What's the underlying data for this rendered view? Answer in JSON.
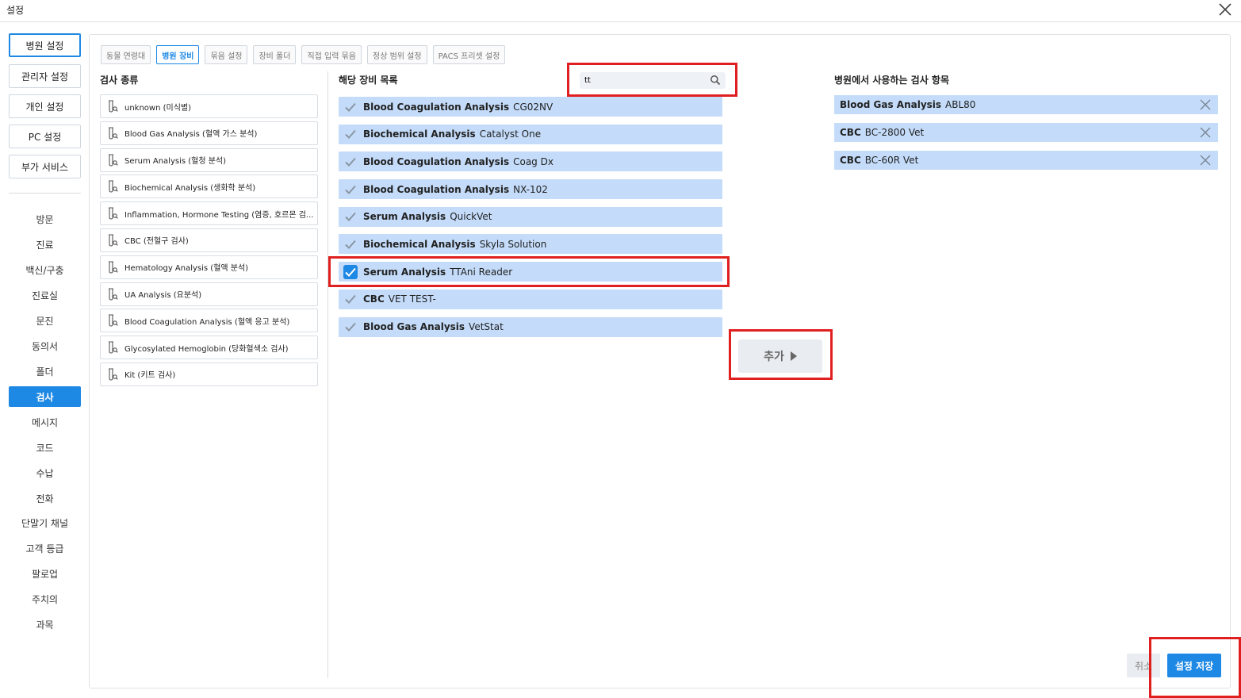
{
  "window": {
    "title": "설정"
  },
  "nav": {
    "buttons": [
      "병원 설정",
      "관리자 설정",
      "개인 설정",
      "PC 설정",
      "부가 서비스"
    ],
    "items": [
      "방문",
      "진료",
      "백신/구충",
      "진료실",
      "문진",
      "동의서",
      "폴더",
      "검사",
      "메시지",
      "코드",
      "수납",
      "전화",
      "단말기 채널",
      "고객 등급",
      "팔로업",
      "주치의",
      "과목"
    ]
  },
  "tabs": [
    "동물 연령대",
    "병원 장비",
    "묶음 설정",
    "장비 폴더",
    "직접 입력 묶음",
    "정상 범위 설정",
    "PACS 프리셋 설정"
  ],
  "columns": {
    "category_title": "검사 종류",
    "equipment_title": "해당 장비 목록",
    "used_title": "병원에서 사용하는 검사 항목"
  },
  "search": {
    "value": "tt"
  },
  "categories": [
    "unknown (미식별)",
    "Blood Gas Analysis (혈액 가스 분석)",
    "Serum Analysis (혈청 분석)",
    "Biochemical Analysis (생화학 분석)",
    "Inflammation, Hormone Testing (염증, 호르몬 검...",
    "CBC (전혈구 검사)",
    "Hematology Analysis (혈액 분석)",
    "UA Analysis (요분석)",
    "Blood Coagulation Analysis (혈액 응고 분석)",
    "Glycosylated Hemoglobin (당화혈색소 검사)",
    "Kit (키트 검사)"
  ],
  "equipment": [
    {
      "category": "Blood Coagulation Analysis",
      "name": "CG02NV",
      "checked": false
    },
    {
      "category": "Biochemical Analysis",
      "name": "Catalyst One",
      "checked": false
    },
    {
      "category": "Blood Coagulation Analysis",
      "name": "Coag Dx",
      "checked": false
    },
    {
      "category": "Blood Coagulation Analysis",
      "name": "NX-102",
      "checked": false
    },
    {
      "category": "Serum Analysis",
      "name": "QuickVet",
      "checked": false
    },
    {
      "category": "Biochemical Analysis",
      "name": "Skyla Solution",
      "checked": false
    },
    {
      "category": "Serum Analysis",
      "name": "TTAni Reader",
      "checked": true
    },
    {
      "category": "CBC",
      "name": "VET TEST-",
      "checked": false
    },
    {
      "category": "Blood Gas Analysis",
      "name": "VetStat",
      "checked": false
    }
  ],
  "used_items": [
    {
      "category": "Blood Gas Analysis",
      "name": "ABL80"
    },
    {
      "category": "CBC",
      "name": "BC-2800 Vet"
    },
    {
      "category": "CBC",
      "name": "BC-60R Vet"
    }
  ],
  "actions": {
    "add_label": "추가",
    "cancel_label": "취소",
    "save_label": "설정 저장"
  },
  "colors": {
    "accent": "#1e88e5",
    "highlight": "#e02020",
    "row_bg": "#c4dcfa"
  }
}
